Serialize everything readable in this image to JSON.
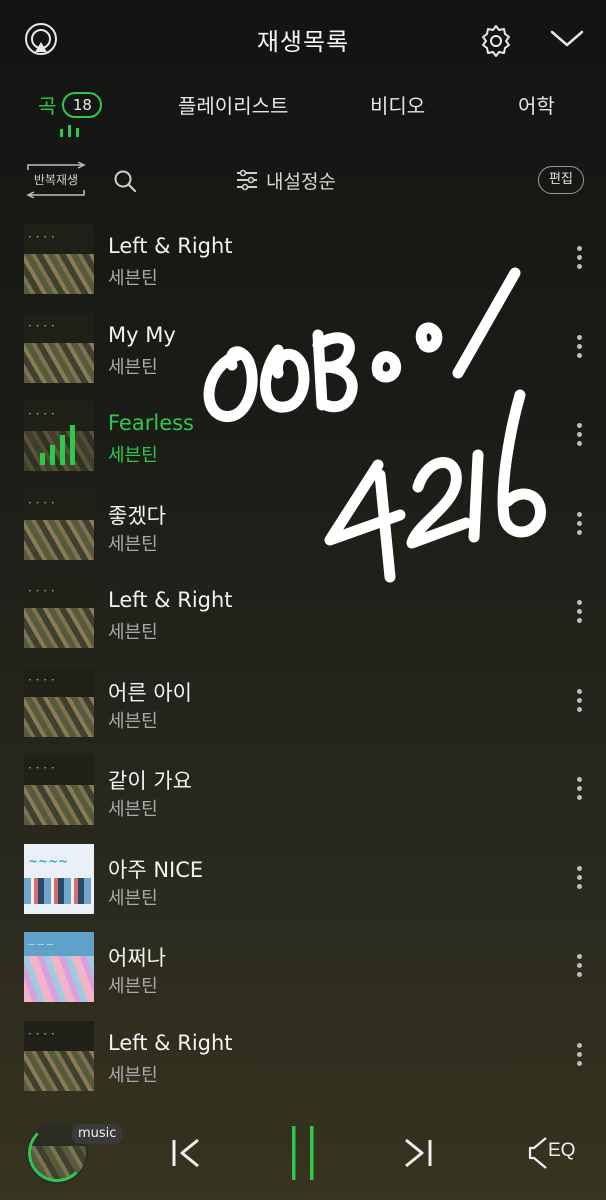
{
  "header": {
    "title": "재생목록"
  },
  "tabs": [
    {
      "label": "곡",
      "count": "18"
    },
    {
      "label": "플레이리스트"
    },
    {
      "label": "비디오"
    },
    {
      "label": "어학"
    }
  ],
  "toolbar": {
    "repeat_label": "반복재생",
    "sort_label": "내설정순",
    "edit_label": "편집"
  },
  "tracks": [
    {
      "title": "Left & Right",
      "artist": "세븐틴",
      "active": false
    },
    {
      "title": "My My",
      "artist": "세븐틴",
      "active": false
    },
    {
      "title": "Fearless",
      "artist": "세븐틴",
      "active": true
    },
    {
      "title": "좋겠다",
      "artist": "세븐틴",
      "active": false
    },
    {
      "title": "Left & Right",
      "artist": "세븐틴",
      "active": false
    },
    {
      "title": "어른 아이",
      "artist": "세븐틴",
      "active": false
    },
    {
      "title": "같이 가요",
      "artist": "세븐틴",
      "active": false
    },
    {
      "title": "아주 NICE",
      "artist": "세븐틴",
      "active": false
    },
    {
      "title": "어쩌나",
      "artist": "세븐틴",
      "active": false
    },
    {
      "title": "Left & Right",
      "artist": "세븐틴",
      "active": false
    }
  ],
  "player": {
    "badge": "music",
    "eq_label": "EQ"
  },
  "colors": {
    "accent": "#2ec84a"
  },
  "icons": [
    "broadcast-icon",
    "gear-icon",
    "chevron-down-icon",
    "equalizer-icon",
    "repeat-icon",
    "search-icon",
    "sort-icon",
    "more-vertical-icon",
    "previous-icon",
    "pause-icon",
    "next-icon",
    "eq-icon"
  ]
}
